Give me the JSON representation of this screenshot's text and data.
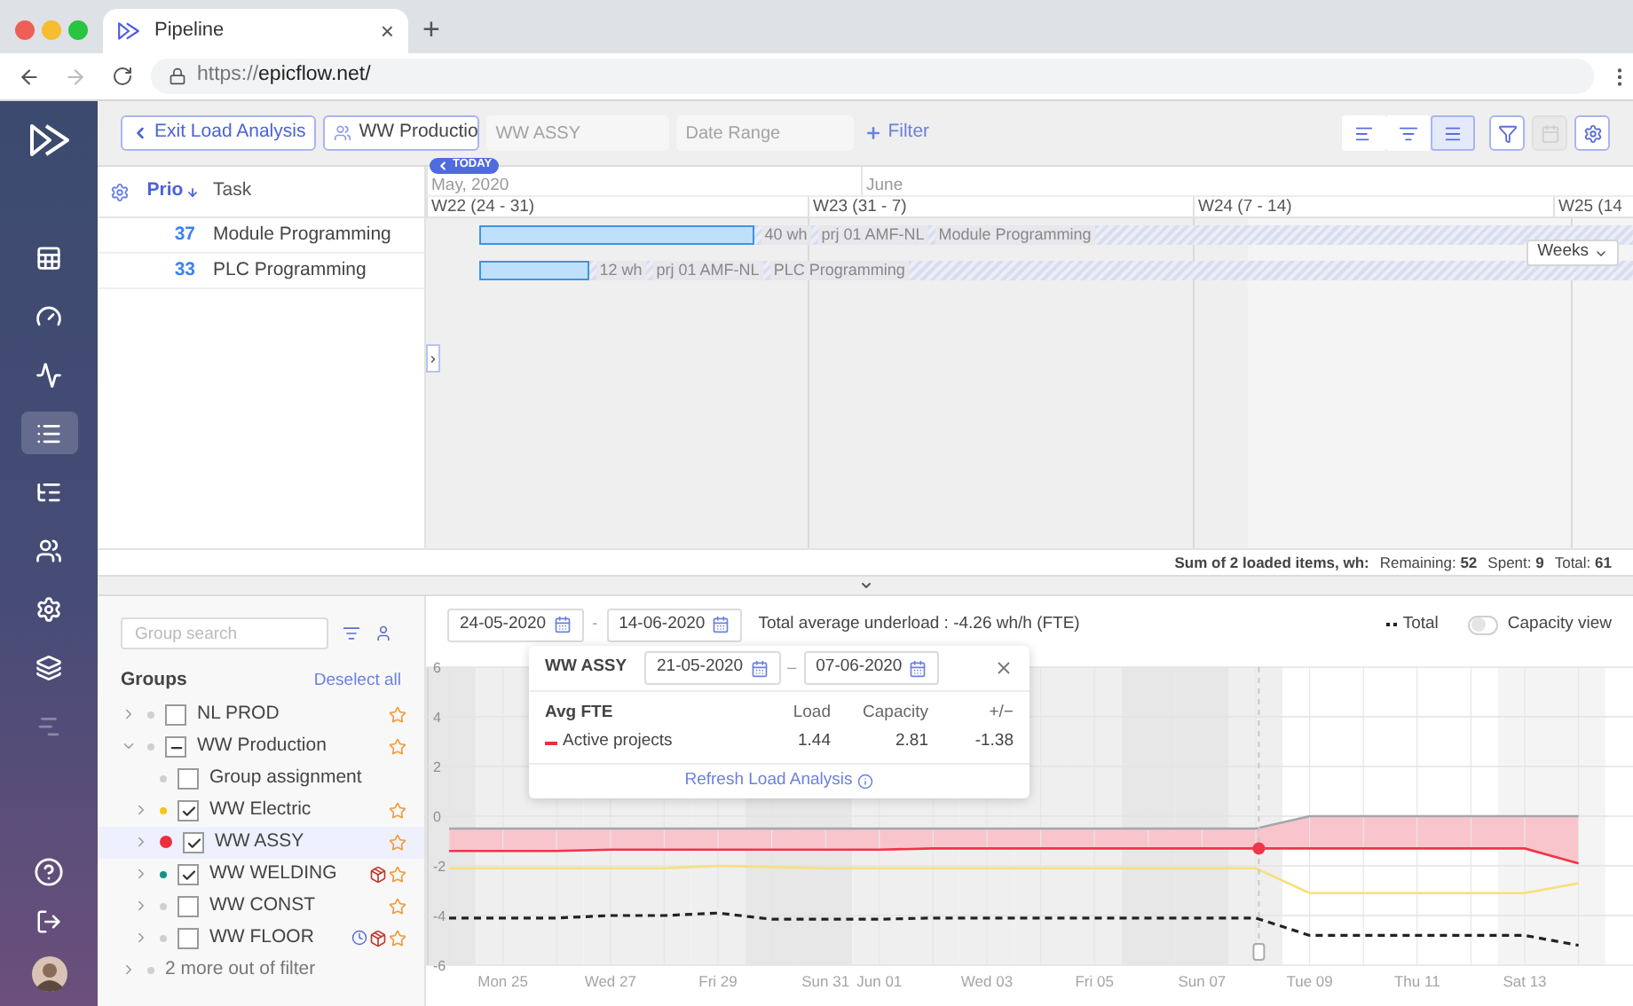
{
  "browser": {
    "tab_title": "Pipeline",
    "close_tab": "×",
    "new_tab": "+",
    "url_scheme": "https://",
    "url_host": "epicflow.net/"
  },
  "sidebar": {
    "items": [
      {
        "kind": "table",
        "selected": false,
        "disabled": false
      },
      {
        "kind": "dashboard",
        "selected": false,
        "disabled": false
      },
      {
        "kind": "pulse",
        "selected": false,
        "disabled": false
      },
      {
        "kind": "list",
        "selected": true,
        "disabled": false
      },
      {
        "kind": "tasks",
        "selected": false,
        "disabled": false
      },
      {
        "kind": "people",
        "selected": false,
        "disabled": false
      },
      {
        "kind": "settings",
        "selected": false,
        "disabled": false
      },
      {
        "kind": "layers",
        "selected": false,
        "disabled": false
      },
      {
        "kind": "reports",
        "selected": false,
        "disabled": true
      }
    ],
    "bottom_items": [
      {
        "kind": "help"
      },
      {
        "kind": "logout"
      },
      {
        "kind": "avatar"
      }
    ]
  },
  "toolbar": {
    "exit_button": "Exit Load Analysis",
    "group_select": "WW Productio",
    "fields": [
      {
        "placeholder": "WW ASSY"
      },
      {
        "placeholder": "Date Range"
      }
    ],
    "filter_button": "Filter",
    "view_buttons": [
      {
        "kind": "tree",
        "selected": false
      },
      {
        "kind": "resources",
        "selected": false
      },
      {
        "kind": "flat",
        "selected": true
      }
    ],
    "tool_buttons": [
      {
        "kind": "funnel",
        "disabled": false
      },
      {
        "kind": "calendar",
        "disabled": true
      },
      {
        "kind": "settings",
        "disabled": false
      }
    ]
  },
  "gantt": {
    "columns": [
      "Prio",
      "Task"
    ],
    "today_badge": "TODAY",
    "months": [
      "May, 2020",
      "June"
    ],
    "weeks": [
      "W22 (24 - 31)",
      "W23 (31 - 7)",
      "W24 (7 - 14)",
      "W25 (14"
    ],
    "zoom_select": "Weeks",
    "rows": [
      {
        "prio": "37",
        "task": "Module Programming",
        "level": 0.238,
        "chips": [
          "40 wh",
          "prj 01 AMF-NL",
          "Module Programming"
        ]
      },
      {
        "prio": "33",
        "task": "PLC Programming",
        "level": 0.095,
        "chips": [
          "12 wh",
          "prj 01 AMF-NL",
          "PLC Programming"
        ]
      }
    ],
    "summary": {
      "label": "Sum of 2 loaded items, wh:",
      "items": [
        "Remaining: **52**",
        "Spent: **9**",
        "Total: **61**"
      ]
    }
  },
  "load_panel": {
    "search": {
      "placeholder": "Group search"
    },
    "title": "Groups",
    "deselect": "Deselect all",
    "groups": [
      {
        "label": "NL PROD",
        "kind": "group",
        "expanded": false,
        "selected": false,
        "checked": false,
        "partial": false,
        "color": "#cfcfcf",
        "clock": false,
        "package": false
      },
      {
        "label": "WW Production",
        "kind": "group",
        "expanded": true,
        "selected": false,
        "checked": false,
        "partial": true,
        "color": "#cfcfcf",
        "clock": false,
        "package": false,
        "children": [
          {
            "label": "Group assignment",
            "kind": "assignment",
            "selected": false,
            "checked": false,
            "partial": false,
            "color": "#cfcfcf"
          },
          {
            "label": "WW Electric",
            "kind": "group",
            "expanded": false,
            "selected": false,
            "checked": true,
            "partial": false,
            "color": "#f5c518",
            "clock": false,
            "package": false
          },
          {
            "label": "WW ASSY",
            "kind": "group",
            "expanded": false,
            "selected": true,
            "checked": true,
            "partial": false,
            "color": "#ee2e3c",
            "clock": false,
            "package": false
          },
          {
            "label": "WW WELDING",
            "kind": "group",
            "expanded": false,
            "selected": false,
            "checked": true,
            "partial": false,
            "color": "#0f9488",
            "clock": false,
            "package": true
          },
          {
            "label": "WW CONST",
            "kind": "group",
            "expanded": false,
            "selected": false,
            "checked": false,
            "partial": false,
            "color": "#cfcfcf",
            "clock": false,
            "package": false
          },
          {
            "label": "WW FLOOR",
            "kind": "group",
            "expanded": false,
            "selected": false,
            "checked": false,
            "partial": false,
            "color": "#cfcfcf",
            "clock": true,
            "package": true
          }
        ]
      },
      {
        "label": "2 more out of filter",
        "kind": "more",
        "expanded": false,
        "color": "#cfcfcf"
      }
    ]
  },
  "chart_panel": {
    "date_from": "24-05-2020",
    "separator": "-",
    "date_to": "14-06-2020",
    "summary": "Total average underload : -4.26 wh/h (FTE)",
    "legend": "Total",
    "capacity_toggle": {
      "label": "Capacity view",
      "on": false
    },
    "chart_data": {
      "type": "line",
      "categories": [
        null,
        "Mon 25",
        null,
        "Wed 27",
        null,
        "Fri 29",
        null,
        "Sun 31",
        "Jun 01",
        null,
        "Wed 03",
        null,
        "Fri 05",
        null,
        "Sun 07",
        null,
        "Tue 09",
        null,
        "Thu 11",
        null,
        "Sat 13",
        null
      ],
      "yticks": [
        6,
        4,
        2,
        0,
        -2,
        -4,
        -6
      ],
      "ylim": [
        -6,
        6
      ],
      "grid": true,
      "series": [
        {
          "color": "#a3a7ab",
          "values": [
            -0.5,
            -0.5,
            -0.5,
            -0.5,
            -0.5,
            -0.5,
            -0.5,
            -0.5,
            -0.5,
            -0.5,
            -0.5,
            -0.5,
            -0.5,
            -0.5,
            -0.5,
            -0.5,
            0,
            0,
            0,
            0,
            0,
            0
          ]
        },
        {
          "color": "#f0344a",
          "values": [
            -1.4,
            -1.4,
            -1.4,
            -1.35,
            -1.35,
            -1.35,
            -1.35,
            -1.35,
            -1.35,
            -1.3,
            -1.3,
            -1.3,
            -1.3,
            -1.3,
            -1.3,
            -1.3,
            -1.3,
            -1.3,
            -1.3,
            -1.3,
            -1.3,
            -1.9
          ]
        },
        {
          "color": "#f7e07a",
          "values": [
            -2.1,
            -2.1,
            -2.1,
            -2.1,
            -2.1,
            -2.0,
            -2.05,
            -2.1,
            -2.1,
            -2.1,
            -2.1,
            -2.1,
            -2.1,
            -2.1,
            -2.1,
            -2.1,
            -3.1,
            -3.1,
            -3.1,
            -3.1,
            -3.1,
            -2.7
          ]
        },
        {
          "color": "#222222",
          "line_style": "dashed",
          "values": [
            -4.1,
            -4.1,
            -4.1,
            -4.0,
            -4.0,
            -3.9,
            -4.15,
            -4.15,
            -4.15,
            -4.1,
            -4.1,
            -4.1,
            -4.1,
            -4.1,
            -4.1,
            -4.1,
            -4.8,
            -4.8,
            -4.8,
            -4.8,
            -4.8,
            -5.2
          ]
        }
      ]
    },
    "elapsed": {
      "level": 0.69
    }
  },
  "popup": {
    "title": "WW ASSY",
    "date_from": "21-05-2020",
    "separator": "–",
    "date_to": "07-06-2020",
    "columns": [
      "Avg FTE",
      "Load",
      "Capacity",
      "+/−"
    ],
    "rows": [
      {
        "name": "Active projects",
        "color": "#ee2e3c",
        "load": "1.44",
        "capacity": "2.81",
        "difference": "-1.38"
      }
    ],
    "refresh": "Refresh Load Analysis"
  }
}
